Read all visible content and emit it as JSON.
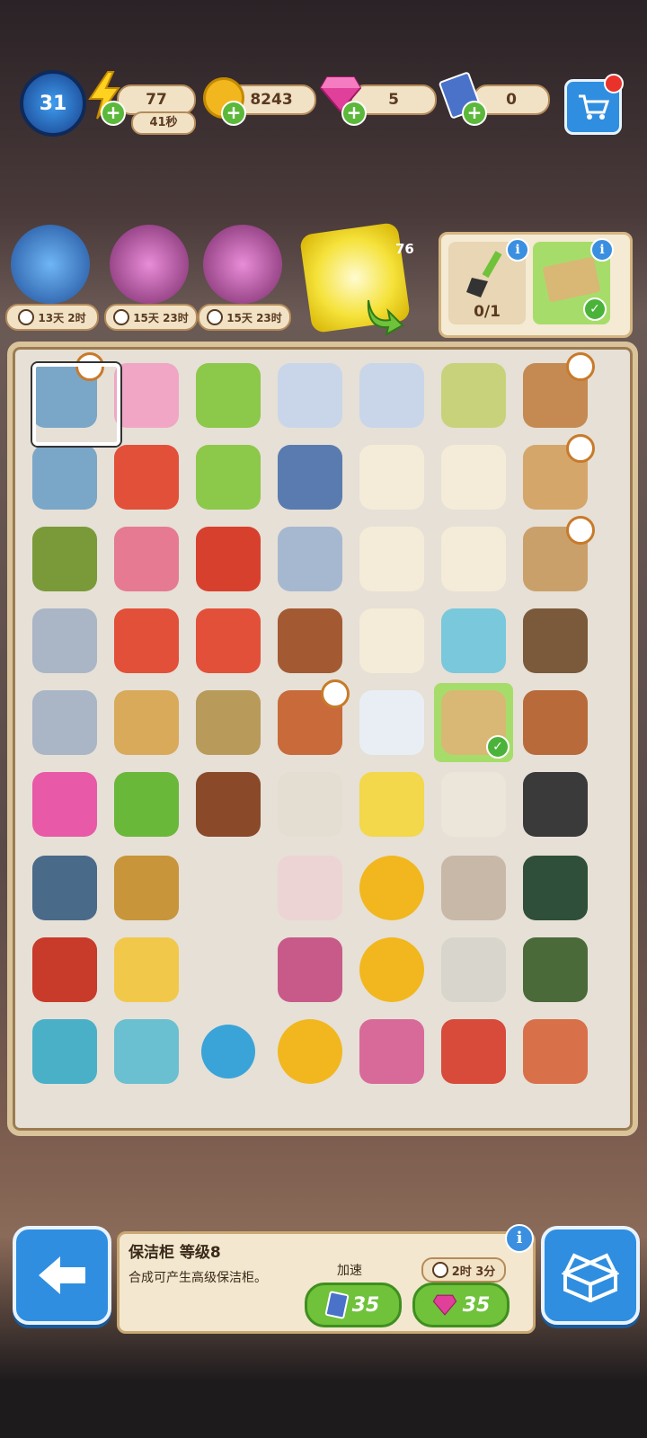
{
  "top_bar": {
    "level": "31",
    "energy": "77",
    "energy_timer": "41秒",
    "coins": "8243",
    "gems": "5",
    "cards": "0"
  },
  "events": [
    {
      "timer": "13天 2时",
      "icon": "tarot-card-deck-icon"
    },
    {
      "timer": "15天 23时",
      "icon": "berry-pie-icon"
    },
    {
      "timer": "15天 23时",
      "icon": "berry-pie-icon"
    }
  ],
  "reward_pile": {
    "count": "76"
  },
  "quest": {
    "progress": "0/1"
  },
  "board": {
    "rows": [
      [
        "cleaning-cabinet",
        "pink-bucket",
        "small-tree",
        "blue-white-vase",
        "blue-white-vase",
        "green-gold-vase",
        "nightstand-with-fruit"
      ],
      [
        "cleaning-cabinet",
        "flower-pot-red-daisy",
        "small-tree",
        "table-saw",
        "white-moth",
        "white-moth",
        "wooden-dresser"
      ],
      [
        "garden-tools-pot",
        "pink-rose-bush",
        "red-flower-tree",
        "folded-cloth",
        "white-moth",
        "white-moth",
        "open-drawers"
      ],
      [
        "paint-can",
        "flower-pot-red-daisy",
        "flower-pot-red-daisy",
        "clay-lamp",
        "white-moth",
        "blue-bowl",
        "brown-moth"
      ],
      [
        "paint-can",
        "wood-planks",
        "photo-locket",
        "broken-clay-pot",
        "glue-tube",
        "treasure-map",
        "hawk-moth"
      ],
      [
        "pink-flower-bush",
        "green-shrub",
        "log-pile",
        "cracked-vase",
        "yellow-sponge",
        "white-moth-small",
        "lantern-with-thread"
      ],
      [
        "open-toolbox",
        "potted-sprout",
        "",
        "cracked-fountain",
        "gold-coins",
        "spotted-moth",
        "lantern-with-box"
      ],
      [
        "red-toolbox",
        "ornate-shrine",
        "",
        "berry-pie-stand",
        "gold-coins",
        "ceramic-vase",
        "lantern-with-bottle"
      ],
      [
        "sprout-blue-pot",
        "soil-blue-pot",
        "blue-star",
        "gold-coins-small",
        "berry-pie",
        "red-race-car",
        "red-race-car-rolled"
      ]
    ]
  },
  "info_panel": {
    "title": "保洁柜 等级8",
    "description": "合成可产生高级保洁柜。",
    "speed_label": "加速",
    "timer": "2时 3分",
    "card_cost": "35",
    "gem_cost": "35"
  },
  "colors": {
    "accent": "#2f8ee0",
    "green": "#6fc23a",
    "gem": "#e0409a",
    "coin": "#f2b71e"
  }
}
